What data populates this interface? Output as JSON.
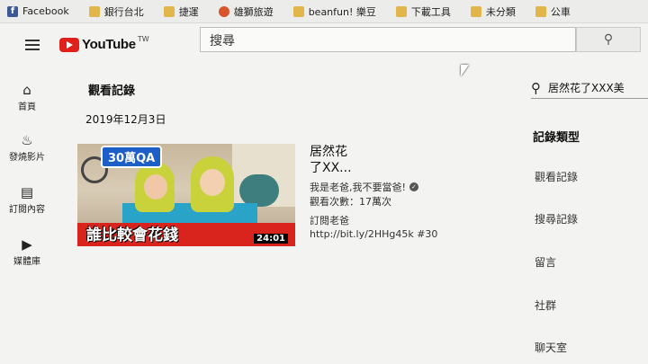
{
  "bookmarks": [
    {
      "label": "Facebook",
      "icon": "facebook-icon"
    },
    {
      "label": "銀行台北",
      "icon": "folder-icon"
    },
    {
      "label": "捷運",
      "icon": "folder-icon"
    },
    {
      "label": "雄獅旅遊",
      "icon": "game-icon"
    },
    {
      "label": "beanfun! 樂豆",
      "icon": "folder-icon"
    },
    {
      "label": "下載工具",
      "icon": "folder-icon"
    },
    {
      "label": "未分類",
      "icon": "folder-icon"
    },
    {
      "label": "公車",
      "icon": "folder-icon"
    }
  ],
  "header": {
    "logo_text": "YouTube",
    "region": "TW",
    "search_value": "搜尋"
  },
  "nav": {
    "items": [
      {
        "label": "首頁",
        "icon": "home-icon"
      },
      {
        "label": "發燒影片",
        "icon": "fire-icon"
      },
      {
        "label": "訂閱內容",
        "icon": "subscriptions-icon"
      },
      {
        "label": "媒體庫",
        "icon": "library-icon"
      }
    ]
  },
  "main": {
    "section_title": "觀看記錄",
    "date_heading": "2019年12月3日",
    "video": {
      "badge": "30萬QA",
      "caption": "誰比較會花錢",
      "duration": "24:01",
      "title_line1": "居然花",
      "title_line2": "了XX...",
      "channel": "我是老爸,我不要當爸!",
      "views": "觀看次數：17萬次",
      "desc_line1": "訂閱老爸",
      "desc_line2": "http://bit.ly/2HHg45k #30"
    }
  },
  "sidebar_right": {
    "search_value": "居然花了XXX美",
    "type_title": "記錄類型",
    "types": [
      "觀看記錄",
      "搜尋記錄",
      "留言",
      "社群",
      "聊天室"
    ]
  },
  "colors": {
    "youtube_red": "#e0201a",
    "thumbnail_banner": "#d8241c",
    "badge_blue": "#1d5fc7"
  }
}
